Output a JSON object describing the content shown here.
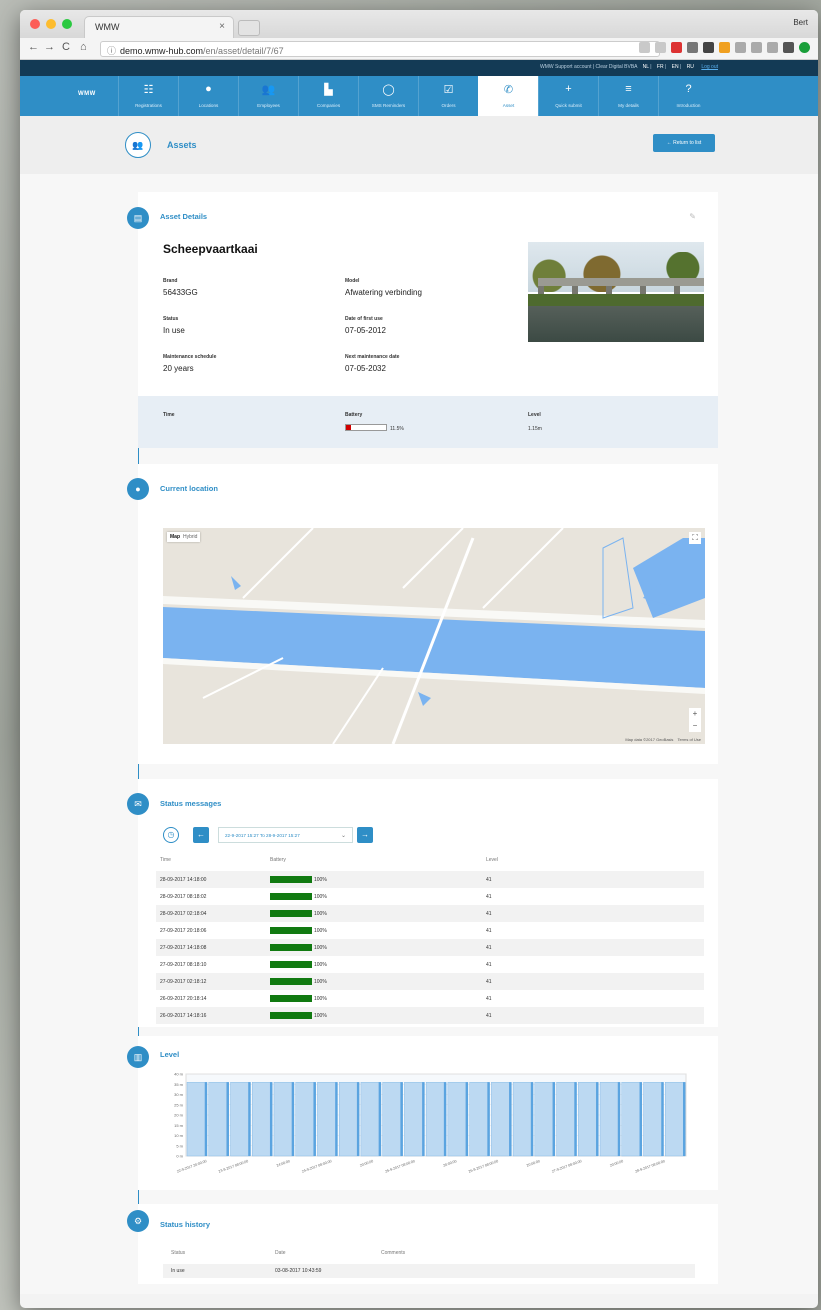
{
  "browser": {
    "tab_title": "WMW",
    "tab_close": "×",
    "profile": "Bert",
    "url_host": "demo.wmw-hub.com",
    "url_path": "/en/asset/detail/7/67",
    "back": "←",
    "forward": "→",
    "reload": "C",
    "home": "⌂",
    "info": "ⓘ"
  },
  "topstrip": {
    "account": "WMW Support account | Clear Digital BVBA",
    "languages": [
      "NL",
      "FR",
      "EN",
      "RU"
    ],
    "logout": "Log out"
  },
  "nav": {
    "logo": "WMW",
    "items": [
      {
        "label": "Registrations",
        "icon": "☷"
      },
      {
        "label": "Locations",
        "icon": "●"
      },
      {
        "label": "Employees",
        "icon": "👥"
      },
      {
        "label": "Companies",
        "icon": "▙"
      },
      {
        "label": "SMS Reminders",
        "icon": "◯"
      },
      {
        "label": "Orders",
        "icon": "☑"
      },
      {
        "label": "Asset",
        "icon": "✆"
      },
      {
        "label": "Quick submit",
        "icon": "+"
      },
      {
        "label": "My details",
        "icon": "≡"
      },
      {
        "label": "Introduction",
        "icon": "?"
      }
    ],
    "active_index": 6
  },
  "page": {
    "icon": "👥",
    "title": "Assets",
    "return_label": "← Return to list"
  },
  "asset_details": {
    "title": "Asset Details",
    "name": "Scheepvaartkaai",
    "brand_label": "Brand",
    "brand": "56433GG",
    "model_label": "Model",
    "model": "Afwatering verbinding",
    "status_label": "Status",
    "status": "In use",
    "first_use_label": "Date of first use",
    "first_use": "07-05-2012",
    "schedule_label": "Maintenance schedule",
    "schedule": "20 years",
    "next_maint_label": "Next maintenance date",
    "next_maint": "07-05-2032",
    "time_label": "Time",
    "battery_label": "Battery",
    "battery_value": "11.5%",
    "battery_fraction": 0.115,
    "level_label": "Level",
    "level_value": "1.15m"
  },
  "location": {
    "title": "Current location",
    "map_toggle_map": "Map",
    "map_toggle_hybrid": "Hybrid",
    "zoom_in": "+",
    "zoom_out": "−",
    "attribution": "Map data ©2017 GeoBasis",
    "terms": "Terms of Use"
  },
  "status_messages": {
    "title": "Status messages",
    "range": "22-9-2017 15:27 To 28-9-2017 15:27",
    "prev": "←",
    "next": "→",
    "headers": {
      "time": "Time",
      "battery": "Battery",
      "level": "Level"
    },
    "rows": [
      {
        "time": "28-09-2017 14:18:00",
        "battery": "100%",
        "level": "41"
      },
      {
        "time": "28-09-2017 08:18:02",
        "battery": "100%",
        "level": "41"
      },
      {
        "time": "28-09-2017 02:18:04",
        "battery": "100%",
        "level": "41"
      },
      {
        "time": "27-09-2017 20:18:06",
        "battery": "100%",
        "level": "41"
      },
      {
        "time": "27-09-2017 14:18:08",
        "battery": "100%",
        "level": "41"
      },
      {
        "time": "27-09-2017 08:18:10",
        "battery": "100%",
        "level": "41"
      },
      {
        "time": "27-09-2017 02:18:12",
        "battery": "100%",
        "level": "41"
      },
      {
        "time": "26-09-2017 20:18:14",
        "battery": "100%",
        "level": "41"
      },
      {
        "time": "26-09-2017 14:18:16",
        "battery": "100%",
        "level": "41"
      }
    ]
  },
  "level_section": {
    "title": "Level"
  },
  "chart_data": {
    "type": "bar",
    "title": "",
    "ylabel": "",
    "ylim": [
      0,
      40
    ],
    "yticks": [
      "0 m",
      "5 m",
      "10 m",
      "15 m",
      "20 m",
      "25 m",
      "30 m",
      "35 m",
      "40 m"
    ],
    "categories": [
      "22-9-2017 20:00:00",
      "23-9-2017 08:00:00",
      "24:00:00",
      "24-9-2017 08:00:00",
      "20:00:00",
      "25-9-2017 08:00:00",
      "20:00:00",
      "26-9-2017 08:00:00",
      "20:00:00",
      "27-9-2017 08:00:00",
      "20:00:00",
      "28-9-2017 08:00:00"
    ],
    "values": [
      36,
      36,
      36,
      36,
      36,
      36,
      36,
      36,
      36,
      36,
      36,
      36,
      36,
      36,
      36,
      36,
      36,
      36,
      36,
      36,
      36,
      36,
      36
    ],
    "grid": true
  },
  "status_history": {
    "title": "Status history",
    "headers": {
      "status": "Status",
      "date": "Date",
      "comments": "Comments"
    },
    "rows": [
      {
        "status": "In use",
        "date": "03-08-2017 10:43:59",
        "comments": ""
      }
    ]
  }
}
